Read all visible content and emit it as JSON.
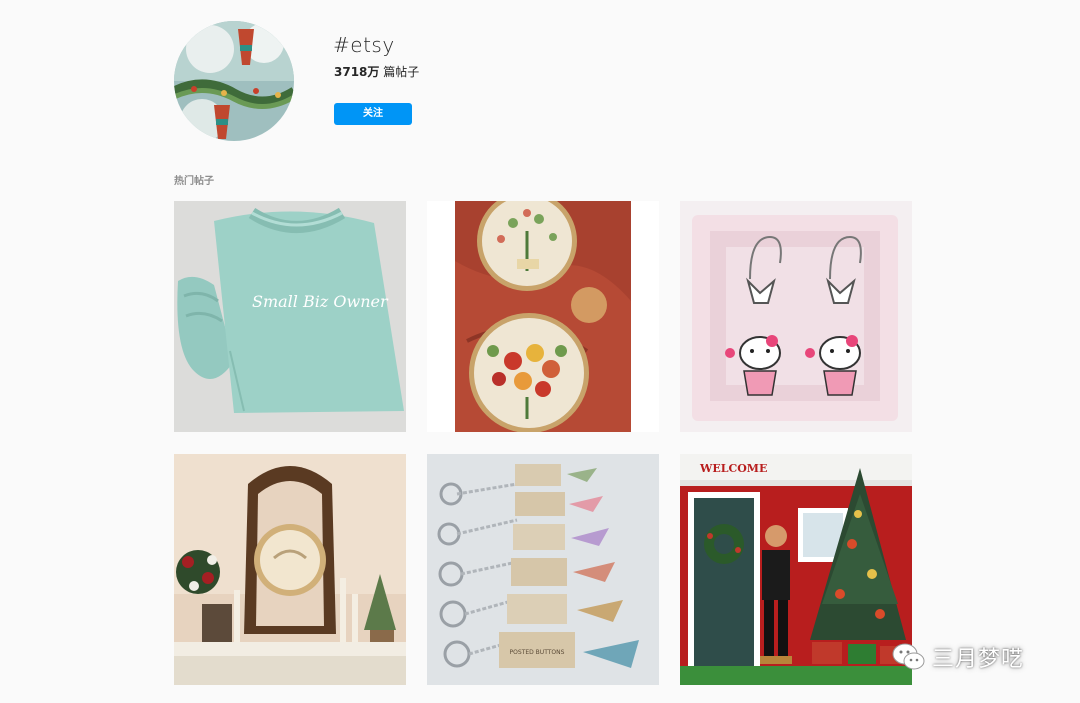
{
  "header": {
    "hashtag": "#etsy",
    "post_count_number": "3718万",
    "post_count_suffix": " 篇帖子",
    "follow_label": "关注"
  },
  "section": {
    "title": "热门帖子"
  },
  "posts": [
    {
      "caption": "Small Biz Owner"
    },
    {
      "caption": ""
    },
    {
      "caption": ""
    },
    {
      "caption": ""
    },
    {
      "caption": "POSTED BUTTONS"
    },
    {
      "caption": "WELCOME"
    }
  ],
  "watermark": {
    "text": "三月梦呓",
    "icon": "wechat-icon"
  },
  "colors": {
    "page_background": "#fafafa",
    "follow_button": "#0095f6",
    "text_primary": "#262626",
    "text_secondary": "#8e8e8e"
  }
}
